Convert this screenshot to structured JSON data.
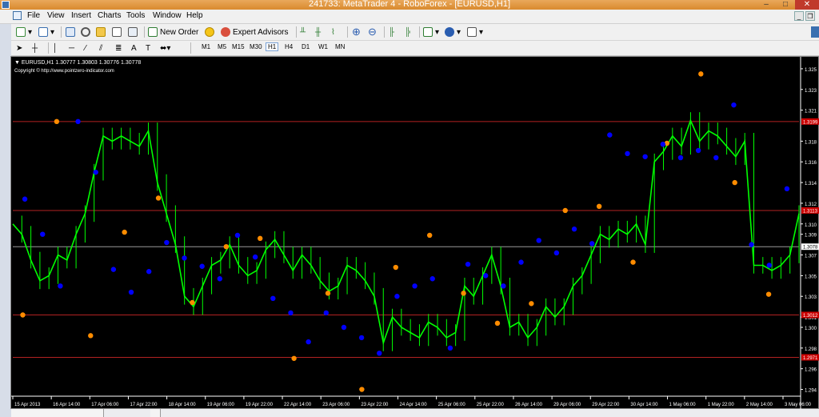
{
  "window": {
    "title": "241733: MetaTrader 4 - RoboForex - [EURUSD,H1]"
  },
  "menu": [
    "File",
    "View",
    "Insert",
    "Charts",
    "Tools",
    "Window",
    "Help"
  ],
  "toolbar": {
    "new_order": "New Order",
    "expert_advisors": "Expert Advisors"
  },
  "timeframes": [
    "M1",
    "M5",
    "M15",
    "M30",
    "H1",
    "H4",
    "D1",
    "W1",
    "MN"
  ],
  "active_timeframe": "H1",
  "chart": {
    "header": "▼ EURUSD,H1  1.30777 1.30803 1.30776 1.30778",
    "copyright": "Copyright © http://www.pointzero-indicator.com"
  },
  "colors": {
    "background": "#000000",
    "candles": "#00ff00",
    "level_lines": "#b22222",
    "upper_fractal": "#ff8c00",
    "lower_fractal": "#0000ff",
    "price_tag": "#cc0000"
  },
  "chart_data": {
    "type": "line",
    "symbol": "EURUSD",
    "timeframe": "H1",
    "ylim": [
      1.2935,
      1.326
    ],
    "y_ticks": [
      "1.325",
      "1.323",
      "1.321",
      "1.318",
      "1.316",
      "1.314",
      "1.312",
      "1.310",
      "1.309",
      "1.307",
      "1.305",
      "1.303",
      "1.301",
      "1.300",
      "1.298",
      "1.296",
      "1.294"
    ],
    "x_ticks": [
      "15 Apr 2013",
      "16 Apr 14:00",
      "17 Apr 06:00",
      "17 Apr 22:00",
      "18 Apr 14:00",
      "19 Apr 06:00",
      "19 Apr 22:00",
      "22 Apr 14:00",
      "23 Apr 06:00",
      "23 Apr 22:00",
      "24 Apr 14:00",
      "25 Apr 06:00",
      "25 Apr 22:00",
      "26 Apr 14:00",
      "29 Apr 06:00",
      "29 Apr 22:00",
      "30 Apr 14:00",
      "1 May 06:00",
      "1 May 22:00",
      "2 May 14:00",
      "3 May 06:00"
    ],
    "level_lines": [
      1.3199,
      1.3113,
      1.3012,
      1.2971
    ],
    "gray_line": 1.3078,
    "price_tags": [
      "1.3078",
      "1.3199",
      "1.3113",
      "1.3012",
      "1.2971"
    ],
    "series": [
      {
        "values": [
          1.31,
          1.309,
          1.3065,
          1.3045,
          1.305,
          1.307,
          1.3065,
          1.309,
          1.311,
          1.315,
          1.3185,
          1.318,
          1.3185,
          1.318,
          1.3175,
          1.319,
          1.314,
          1.311,
          1.308,
          1.303,
          1.302,
          1.304,
          1.306,
          1.3065,
          1.308,
          1.306,
          1.305,
          1.3055,
          1.3075,
          1.3085,
          1.307,
          1.3055,
          1.307,
          1.306,
          1.3045,
          1.3035,
          1.304,
          1.306,
          1.3055,
          1.3045,
          1.303,
          1.2985,
          1.301,
          1.3,
          1.2995,
          1.299,
          1.3005,
          1.3,
          1.299,
          1.2995,
          1.304,
          1.303,
          1.305,
          1.307,
          1.304,
          1.3,
          1.3005,
          1.299,
          1.3,
          1.302,
          1.301,
          1.302,
          1.304,
          1.305,
          1.307,
          1.309,
          1.3085,
          1.3095,
          1.309,
          1.31,
          1.308,
          1.316,
          1.317,
          1.3185,
          1.3175,
          1.32,
          1.318,
          1.319,
          1.3185,
          1.3175,
          1.3165,
          1.318,
          1.306,
          1.306,
          1.3055,
          1.306,
          1.307,
          1.311
        ]
      }
    ],
    "upper_fractals": [
      [
        1.3012
      ],
      [
        1.3199
      ],
      [
        1.2992
      ],
      [
        1.3092
      ],
      [
        1.3125
      ],
      [
        1.3024
      ],
      [
        1.3078
      ],
      [
        1.3086
      ],
      [
        1.297
      ],
      [
        1.3033
      ],
      [
        1.294
      ],
      [
        1.3058
      ],
      [
        1.3089
      ],
      [
        1.3033
      ],
      [
        1.3004
      ],
      [
        1.3023
      ],
      [
        1.3113
      ],
      [
        1.3117
      ],
      [
        1.3063
      ],
      [
        1.3178
      ],
      [
        1.3245
      ],
      [
        1.314
      ],
      [
        1.3032
      ]
    ],
    "lower_fractals": [
      [
        1.3124
      ],
      [
        1.309
      ],
      [
        1.304
      ],
      [
        1.3199
      ],
      [
        1.315
      ],
      [
        1.3056
      ],
      [
        1.3034
      ],
      [
        1.3054
      ],
      [
        1.3082
      ],
      [
        1.3067
      ],
      [
        1.3059
      ],
      [
        1.3047
      ],
      [
        1.3089
      ],
      [
        1.3068
      ],
      [
        1.3028
      ],
      [
        1.3014
      ],
      [
        1.2986
      ],
      [
        1.3014
      ],
      [
        1.3
      ],
      [
        1.299
      ],
      [
        1.2975
      ],
      [
        1.303
      ],
      [
        1.304
      ],
      [
        1.3047
      ],
      [
        1.298
      ],
      [
        1.3061
      ],
      [
        1.305
      ],
      [
        1.304
      ],
      [
        1.3063
      ],
      [
        1.3084
      ],
      [
        1.3072
      ],
      [
        1.3095
      ],
      [
        1.3081
      ],
      [
        1.3186
      ],
      [
        1.3168
      ],
      [
        1.3165
      ],
      [
        1.3177
      ],
      [
        1.3164
      ],
      [
        1.3171
      ],
      [
        1.3164
      ],
      [
        1.3215
      ],
      [
        1.308
      ],
      [
        1.306
      ],
      [
        1.3134
      ]
    ]
  }
}
